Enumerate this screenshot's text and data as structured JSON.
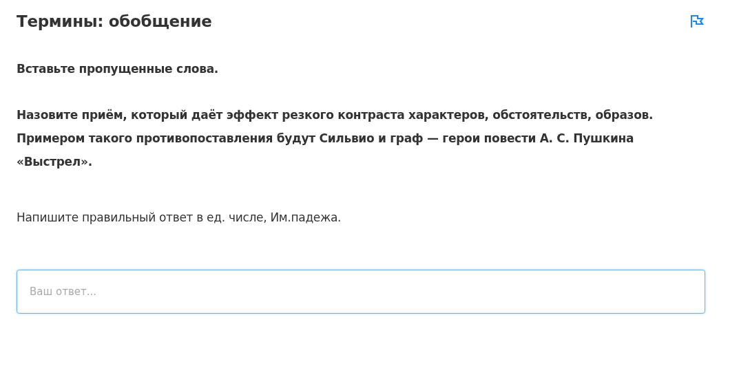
{
  "title": "Термины: обобщение",
  "instruction": "Вставьте пропущенные слова.",
  "question": "Назовите приём, который даёт эффект резкого контраста характеров, обстоятельств, образов. Примером такого противопоставления будут Сильвио и граф — герои повести А. С. Пушкина «Выстрел».",
  "hint": "Напишите правильный ответ в ед. числе, Им.падежа.",
  "answer": {
    "placeholder": "Ваш ответ..."
  }
}
